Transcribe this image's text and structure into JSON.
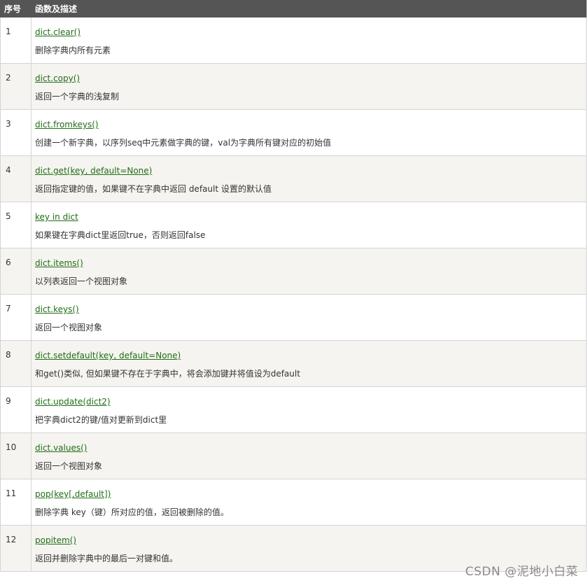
{
  "table": {
    "header": {
      "num_label": "序号",
      "desc_label": "函数及描述"
    },
    "rows": [
      {
        "num": "1",
        "func": "dict.clear()",
        "desc": "删除字典内所有元素"
      },
      {
        "num": "2",
        "func": "dict.copy()",
        "desc": "返回一个字典的浅复制"
      },
      {
        "num": "3",
        "func": "dict.fromkeys()",
        "desc": "创建一个新字典，以序列seq中元素做字典的键，val为字典所有键对应的初始值"
      },
      {
        "num": "4",
        "func": "dict.get(key, default=None)",
        "desc": "返回指定键的值，如果键不在字典中返回 default 设置的默认值"
      },
      {
        "num": "5",
        "func": "key in dict",
        "desc": "如果键在字典dict里返回true，否则返回false"
      },
      {
        "num": "6",
        "func": "dict.items()",
        "desc": "以列表返回一个视图对象"
      },
      {
        "num": "7",
        "func": "dict.keys()",
        "desc": "返回一个视图对象"
      },
      {
        "num": "8",
        "func": "dict.setdefault(key, default=None)",
        "desc": "和get()类似, 但如果键不存在于字典中，将会添加键并将值设为default"
      },
      {
        "num": "9",
        "func": "dict.update(dict2)",
        "desc": "把字典dict2的键/值对更新到dict里"
      },
      {
        "num": "10",
        "func": "dict.values()",
        "desc": "返回一个视图对象"
      },
      {
        "num": "11",
        "func": "pop(key[,default])",
        "desc": "删除字典 key（键）所对应的值，返回被删除的值。"
      },
      {
        "num": "12",
        "func": "popitem()",
        "desc": "返回并删除字典中的最后一对键和值。"
      }
    ]
  },
  "watermark": "CSDN @泥地小白菜",
  "colors": {
    "header_bg": "#555555",
    "link": "#1f6e16",
    "alt_row_bg": "#f6f4f0"
  }
}
